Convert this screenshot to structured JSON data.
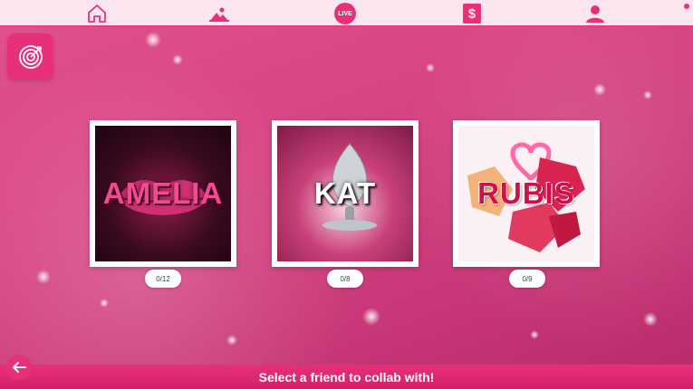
{
  "nav": {
    "items": [
      {
        "name": "home-icon"
      },
      {
        "name": "gallery-icon"
      },
      {
        "name": "live-badge",
        "label": "LIVE"
      },
      {
        "name": "dollar-tag-icon"
      },
      {
        "name": "profile-icon"
      }
    ]
  },
  "target_button": {
    "icon": "target-icon"
  },
  "friends": [
    {
      "name": "AMELIA",
      "progress": "0/12"
    },
    {
      "name": "KAT",
      "progress": "0/8"
    },
    {
      "name": "RUBIS",
      "progress": "0/9"
    }
  ],
  "footer": {
    "back_icon": "arrow-left-icon",
    "prompt": "Select a friend to collab with!"
  },
  "colors": {
    "accent": "#e8307a",
    "nav_bg": "#fbe6ef",
    "background": "#d94585"
  }
}
